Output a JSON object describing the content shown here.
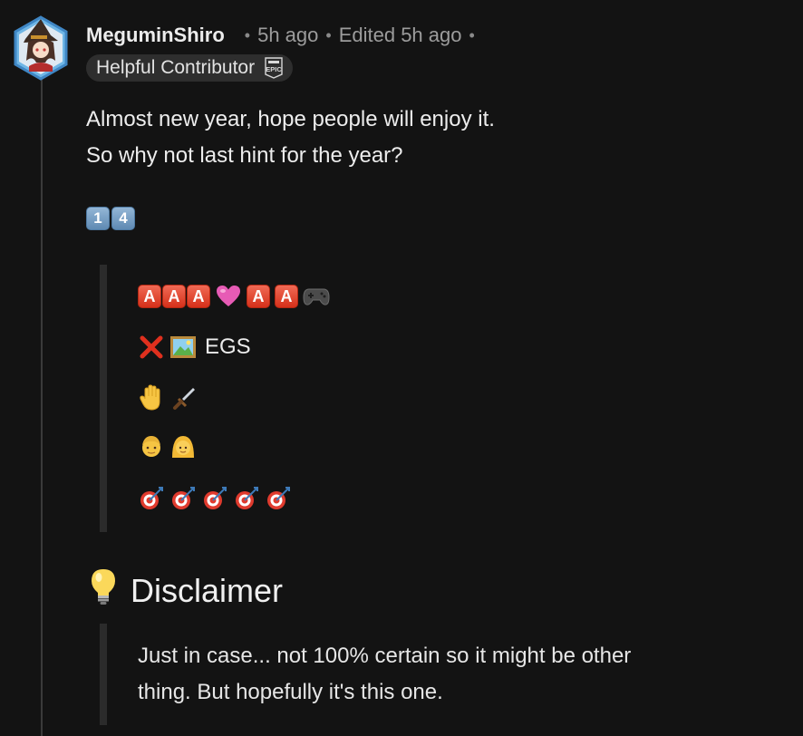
{
  "comment": {
    "author": "MeguminShiro",
    "posted": "5h ago",
    "edited": "Edited 5h ago",
    "separator": "•",
    "flair": {
      "label": "Helpful Contributor",
      "badge_icon": "epic-games-badge-icon"
    },
    "body_lines": [
      "Almost new year, hope people will enjoy it.",
      "So why not last hint for the year?"
    ],
    "keycaps": [
      "1",
      "4"
    ],
    "hint_quote": {
      "line1": {
        "a_letter": "A",
        "icons": [
          "a-button-icon",
          "a-button-icon",
          "a-button-icon",
          "pink-heart-icon",
          "a-button-icon",
          "a-button-icon",
          "game-controller-icon"
        ]
      },
      "line2": {
        "icons": [
          "cross-mark-icon",
          "framed-picture-icon"
        ],
        "text": "EGS"
      },
      "line3": {
        "icons": [
          "raised-hand-icon",
          "dagger-icon"
        ]
      },
      "line4": {
        "icons": [
          "man-blond-icon",
          "woman-blond-icon"
        ]
      },
      "line5": {
        "icons": [
          "direct-hit-icon",
          "direct-hit-icon",
          "direct-hit-icon",
          "direct-hit-icon",
          "direct-hit-icon"
        ]
      }
    },
    "disclaimer": {
      "icon": "light-bulb-icon",
      "heading": "Disclaimer",
      "text_lines": [
        "Just in case... not 100% certain so it might be other",
        "thing. But hopefully it's this one."
      ]
    }
  },
  "colors": {
    "background": "#131313",
    "text": "#ededed",
    "meta": "#9c9c9c",
    "flair_bg": "#2e2e2e",
    "quote_bar": "#2b2b2b",
    "thread_line": "#3a3a3a"
  }
}
